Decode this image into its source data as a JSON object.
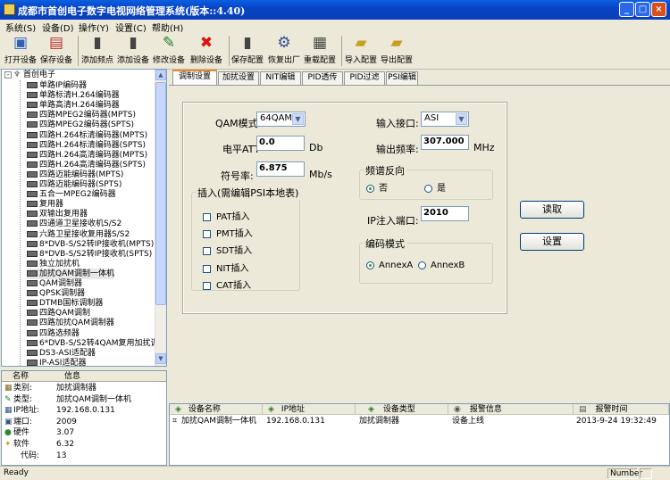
{
  "window": {
    "title": "成都市首创电子数字电视网络管理系统(版本::4.40)"
  },
  "menu": [
    {
      "label": "系统(S)"
    },
    {
      "label": "设备(D)"
    },
    {
      "label": "操作(Y)"
    },
    {
      "label": "设置(C)"
    },
    {
      "label": "帮助(H)"
    }
  ],
  "toolbar": [
    {
      "label": "打开设备",
      "icon": "open-device-icon"
    },
    {
      "label": "保存设备",
      "icon": "save-device-icon"
    },
    {
      "label": "添加频点",
      "icon": "add-frequency-icon"
    },
    {
      "label": "添加设备",
      "icon": "add-device-icon"
    },
    {
      "label": "修改设备",
      "icon": "edit-device-icon"
    },
    {
      "label": "删除设备",
      "icon": "delete-device-icon"
    },
    {
      "label": "保存配置",
      "icon": "save-config-icon"
    },
    {
      "label": "恢复出厂",
      "icon": "factory-reset-icon"
    },
    {
      "label": "重载配置",
      "icon": "reload-config-icon"
    },
    {
      "label": "导入配置",
      "icon": "import-config-icon"
    },
    {
      "label": "导出配置",
      "icon": "export-config-icon"
    }
  ],
  "tree": {
    "root": "首创电子",
    "items": [
      "单路IP编码器",
      "单路标清H.264编码器",
      "单路高清H.264编码器",
      "四路MPEG2编码器(MPTS)",
      "四路MPEG2编码器(SPTS)",
      "四路H.264标清编码器(MPTS)",
      "四路H.264标清编码器(SPTS)",
      "四路H.264高清编码器(MPTS)",
      "四路H.264高清编码器(SPTS)",
      "四路迈能编码器(MPTS)",
      "四路迈能编码器(SPTS)",
      "五合一MPEG2编码器",
      "复用器",
      "双输出复用器",
      "四通道卫星接收机S/S2",
      "六路卫星接收复用器S/S2",
      "8*DVB-S/S2转IP接收机(MPTS)",
      "8*DVB-S/S2转IP接收机(SPTS)",
      "独立加扰机",
      "加扰QAM调制一体机",
      "QAM调制器",
      "QPSK调制器",
      "DTMB国标调制器",
      "四路QAM调制",
      "四路加扰QAM调制器",
      "四路选频器",
      "6*DVB-S/S2转4QAM复用加扰调制器",
      "DS3-ASI适配器",
      "IP-ASI适配器"
    ],
    "selected_index": 19
  },
  "info": {
    "headers": {
      "name": "名称",
      "info": "信息"
    },
    "rows": [
      {
        "name": "类别:",
        "value": "加扰调制器"
      },
      {
        "name": "类型:",
        "value": "加扰QAM调制一体机"
      },
      {
        "name": "IP地址:",
        "value": "192.168.0.131"
      },
      {
        "name": "端口:",
        "value": "2009"
      },
      {
        "name": "硬件",
        "value": "3.07"
      },
      {
        "name": "软件",
        "value": "6.32"
      },
      {
        "name": "代码:",
        "value": "13"
      }
    ]
  },
  "tabs": [
    "调制设置",
    "加扰设置",
    "NIT编辑",
    "PID透传",
    "PID过滤",
    "PSI编辑"
  ],
  "active_tab": 0,
  "form": {
    "qam_label": "QAM模式:",
    "qam_value": "64QAM",
    "level_label": "电平ATT",
    "level_value": "0.0",
    "level_unit": "Db",
    "symbol_label": "符号率:",
    "symbol_value": "6.875",
    "symbol_unit": "Mb/s",
    "input_label": "输入接口:",
    "input_value": "ASI",
    "freq_label": "输出频率:",
    "freq_value": "307.000",
    "freq_unit": "MHz",
    "spectrum_title": "频谱反向",
    "spectrum_no": "否",
    "spectrum_yes": "是",
    "ip_port_label": "IP注入端口:",
    "ip_port_value": "2010",
    "insert_title": "插入(需编辑PSI本地表)",
    "insert_items": [
      "PAT插入",
      "PMT插入",
      "SDT插入",
      "NIT插入",
      "CAT插入"
    ],
    "encode_title": "编码模式",
    "encode_a": "AnnexA",
    "encode_b": "AnnexB",
    "read_button": "读取",
    "set_button": "设置"
  },
  "list": {
    "headers": [
      "设备名称",
      "IP地址",
      "设备类型",
      "报警信息",
      "报警时间"
    ],
    "rows": [
      [
        "加扰QAM调制一体机",
        "192.168.0.131",
        "加扰调制器",
        "设备上线",
        "2013-9-24 19:32:49"
      ]
    ]
  },
  "status": {
    "left": "Ready",
    "right": "Number"
  }
}
